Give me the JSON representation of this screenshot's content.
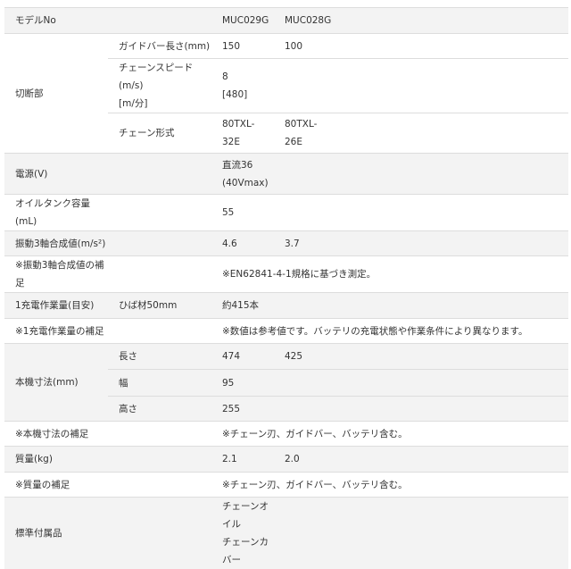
{
  "spec_table": {
    "rows": [
      {
        "label": "モデルNo",
        "gray": true,
        "subrows": [
          {
            "sub": "",
            "v1": "MUC029G",
            "v2": "MUC028G",
            "h": 29
          }
        ]
      },
      {
        "label": "切断部",
        "gray": false,
        "subrows": [
          {
            "sub": "ガイドバー長さ(mm)",
            "v1": "150",
            "v2": "100",
            "h": 28
          },
          {
            "sub": "チェーンスピード(m/s)\n[m/分]",
            "v1": "8\n[480]",
            "v2": "",
            "h": 46
          },
          {
            "sub": "チェーン形式",
            "v1": "80TXL-\n32E",
            "v2": "80TXL-\n26E",
            "h": 45
          }
        ]
      },
      {
        "label": "電源(V)",
        "gray": true,
        "subrows": [
          {
            "sub": "",
            "v1": "直流36\n(40Vmax)",
            "v2": "",
            "h": 46
          }
        ]
      },
      {
        "label": "オイルタンク容量(mL)",
        "gray": false,
        "subrows": [
          {
            "sub": "",
            "v1": "55",
            "v2": "",
            "h": 28
          }
        ]
      },
      {
        "label": "振動3軸合成値(m/s²)",
        "gray": true,
        "subrows": [
          {
            "sub": "",
            "v1": "4.6",
            "v2": "3.7",
            "h": 28
          }
        ]
      },
      {
        "label": "※振動3軸合成値の補足",
        "gray": false,
        "subrows": [
          {
            "sub": "",
            "note": "※EN62841-4-1規格に基づき測定。",
            "h": 28
          }
        ]
      },
      {
        "label": "1充電作業量(目安)",
        "gray": true,
        "subrows": [
          {
            "sub": "ひば材50mm",
            "v1": "約415本",
            "v2": "",
            "h": 29
          }
        ]
      },
      {
        "label": "※1充電作業量の補足",
        "gray": false,
        "subrows": [
          {
            "sub": "",
            "note": "※数値は参考値です。バッテリの充電状態や作業条件により異なります。",
            "h": 28
          }
        ]
      },
      {
        "label": "本機寸法(mm)",
        "gray": true,
        "subrows": [
          {
            "sub": "長さ",
            "v1": "474",
            "v2": "425",
            "h": 29
          },
          {
            "sub": "幅",
            "v1": "95",
            "v2": "",
            "h": 30
          },
          {
            "sub": "高さ",
            "v1": "255",
            "v2": "",
            "h": 28
          }
        ]
      },
      {
        "label": "※本機寸法の補足",
        "gray": false,
        "subrows": [
          {
            "sub": "",
            "note": "※チェーン刃、ガイドバー、バッテリ含む。",
            "h": 28
          }
        ]
      },
      {
        "label": "質量(kg)",
        "gray": true,
        "subrows": [
          {
            "sub": "",
            "v1": "2.1",
            "v2": "2.0",
            "h": 29
          }
        ]
      },
      {
        "label": "※質量の補足",
        "gray": false,
        "subrows": [
          {
            "sub": "",
            "note": "※チェーン刃、ガイドバー、バッテリ含む。",
            "h": 28
          }
        ]
      },
      {
        "label": "標準付属品",
        "gray": true,
        "subrows": [
          {
            "sub": "",
            "v1": "チェーンオイル\nチェーンカバー",
            "v2": "",
            "h": 45
          }
        ]
      }
    ]
  }
}
